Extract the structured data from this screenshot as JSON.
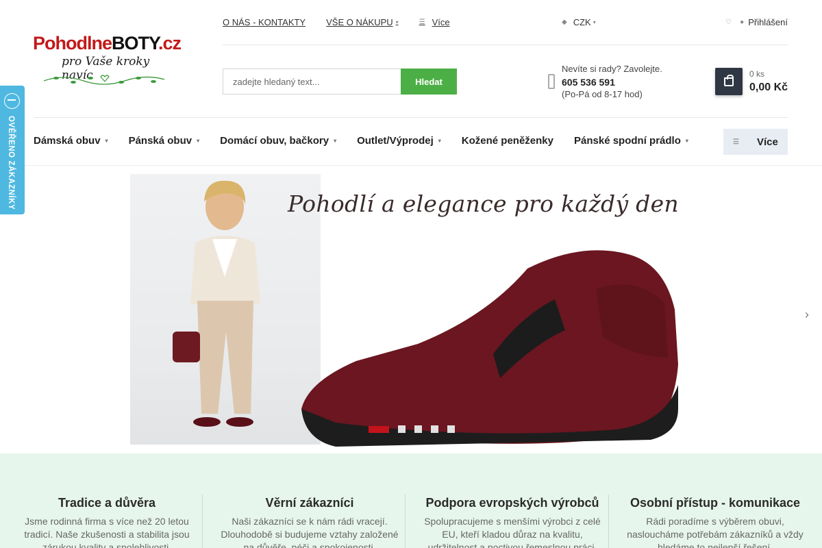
{
  "logo": {
    "part1": "Pohodlne",
    "part2": "BOTY",
    "part3": ".cz",
    "tagline": "pro Vaše kroky navíc"
  },
  "topnav": {
    "about": "O NÁS - KONTAKTY",
    "shopping": "VŠE O NÁKUPU",
    "more": "Více"
  },
  "currency": "CZK",
  "login": "Přihlášení",
  "search": {
    "placeholder": "zadejte hledaný text...",
    "button": "Hledat"
  },
  "contact": {
    "question": "Nevíte si rady? Zavolejte.",
    "phone": "605 536 591",
    "hours": "(Po-Pá od 8-17 hod)"
  },
  "cart": {
    "count": "0 ks",
    "total": "0,00 Kč"
  },
  "mainnav": {
    "items": [
      {
        "label": "Dámská obuv"
      },
      {
        "label": "Pánská obuv"
      },
      {
        "label": "Domácí obuv, bačkory"
      },
      {
        "label": "Outlet/Výprodej"
      },
      {
        "label": "Kožené peněženky"
      },
      {
        "label": "Pánské spodní prádlo"
      }
    ],
    "more": "Více"
  },
  "badge": "OVĚŘENO ZÁKAZNÍKY",
  "banner": {
    "headline": "Pohodlí a elegance pro každý den",
    "slides": 5,
    "active_slide": 1
  },
  "features": [
    {
      "title": "Tradice a důvěra",
      "text": "Jsme rodinná firma s více než 20 letou tradicí. Naše zkušenosti a stabilita jsou zárukou kvality a spolehlivosti."
    },
    {
      "title": "Věrní zákazníci",
      "text": "Naši zákazníci se k nám rádi vracejí. Dlouhodobě si budujeme vztahy založené na důvěře, péči a spokojenosti."
    },
    {
      "title": "Podpora evropských výrobců",
      "text": "Spolupracujeme s menšími výrobci z celé EU, kteří kladou důraz na kvalitu, udržitelnost a poctivou řemeslnou práci."
    },
    {
      "title": "Osobní přístup - komunikace",
      "text": "Rádi poradíme s výběrem obuvi, nasloucháme potřebám zákazníků a vždy hledáme to nejlepší řešení."
    }
  ],
  "colors": {
    "brand_red": "#c21a1a",
    "search_green": "#4caf46",
    "cart_dark": "#2f3744",
    "badge_blue": "#4eb8e0",
    "features_bg": "#e7f6ec"
  }
}
